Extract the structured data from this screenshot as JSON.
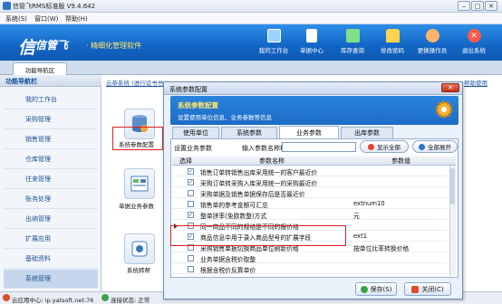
{
  "window": {
    "title": "信管飞RMS标准版 V9.4.642"
  },
  "menu": [
    "系统(S)",
    "窗口(W)",
    "帮助(H)"
  ],
  "banner": {
    "logo_mark": "信",
    "logo": "信管飞",
    "slogan": "· 精细化管理软件",
    "buttons": [
      {
        "label": "我的工作台",
        "icon": "monitor-icon",
        "color": "#9fd3ff"
      },
      {
        "label": "单据中心",
        "icon": "document-icon",
        "color": "#ffffff"
      },
      {
        "label": "库存查询",
        "icon": "warehouse-icon",
        "color": "#7fe08a"
      },
      {
        "label": "修改密码",
        "icon": "lock-icon",
        "color": "#ffd34d"
      },
      {
        "label": "更换操作员",
        "icon": "user-icon",
        "color": "#ffb36b"
      },
      {
        "label": "退出系统",
        "icon": "exit-icon",
        "color": "#ff5a4a"
      }
    ]
  },
  "tab": {
    "label": "功能导航区"
  },
  "nav": {
    "header": "功能导航栏",
    "items": [
      "我的工作台",
      "采购管理",
      "销售管理",
      "仓库管理",
      "往来管理",
      "账务处理",
      "出纳管理",
      "扩展应用",
      "基础资料",
      "系统管理"
    ],
    "active_index": 9
  },
  "content": {
    "breadcrumb": "云恭系统 (进行证书书",
    "right_link": "帮助使用",
    "panels": [
      {
        "label": "系统参数配置",
        "icon": "database-icon"
      },
      {
        "label": "单据业务参数",
        "icon": "form-icon"
      },
      {
        "label": "系统转帮",
        "icon": "app-icon"
      }
    ]
  },
  "status": {
    "left": "云应用中心: ip.yatsoft.net:76",
    "right": "连接状态: 正常"
  },
  "dialog": {
    "title": "系统参数配置",
    "close": "✕",
    "header_title": "系统参数配置",
    "header_sub": "设置使用单位信息、业务参数等信息",
    "tabs": [
      "使用单位",
      "系统参数",
      "业务参数",
      "出库参数"
    ],
    "active_tab": 2,
    "settings_label": "设置业务参数",
    "search_label": "输入参数名称检索：",
    "search_value": "",
    "show_all": "显示全部",
    "expand_all": "全部展开",
    "columns": [
      "选择",
      "参数名称",
      "参数值"
    ],
    "rows": [
      {
        "checked": true,
        "name": "销售订单转销售出库采用统一的客户最近价",
        "value": ""
      },
      {
        "checked": true,
        "name": "采购订单转采购入库采用统一的采购最近价",
        "value": ""
      },
      {
        "checked": false,
        "name": "采购单据及销售单据保存后是否最近价",
        "value": ""
      },
      {
        "checked": false,
        "name": "销售单的参考金额可汇总",
        "value": "extnum10"
      },
      {
        "checked": true,
        "name": "整单拼率(免欧数整)方式",
        "value": "元"
      },
      {
        "checked": false,
        "name": "同一商品不同的规格是不同的报价格",
        "value": ""
      },
      {
        "checked": true,
        "name": "商品信息中用于录入商品型号的扩展字段",
        "value": "ext1"
      },
      {
        "checked": false,
        "name": "采购销售单据切换商品单位刷新价格",
        "value": "按单位比率转换价格"
      },
      {
        "checked": false,
        "name": "业务单据含税价取整",
        "value": ""
      },
      {
        "checked": false,
        "name": "根据含税价反算单价",
        "value": ""
      }
    ],
    "selected_row": 5,
    "save": "保存(S)",
    "close_button": "关闭(C)"
  }
}
